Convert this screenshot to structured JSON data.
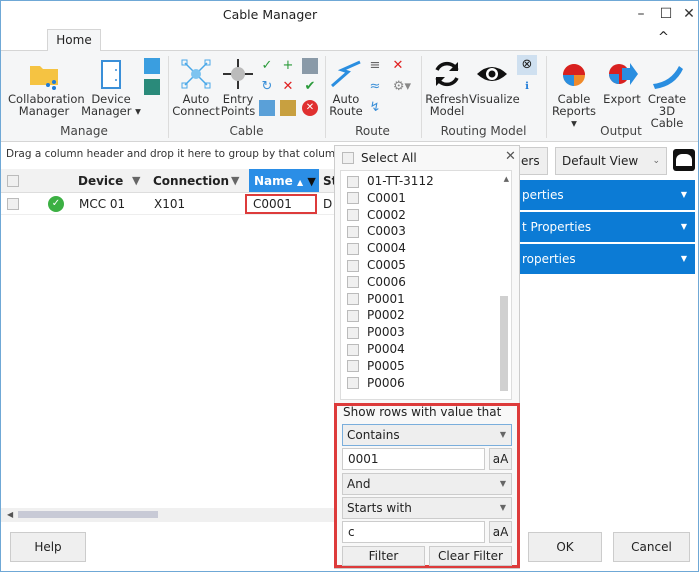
{
  "window": {
    "title": "Cable Manager",
    "minimize": "–",
    "maximize": "☐",
    "close": "✕",
    "collapse": "^"
  },
  "ribbon": {
    "tab": "Home",
    "groups": {
      "manage": {
        "label": "Manage",
        "collab": [
          "Collaboration",
          "Manager"
        ],
        "device": [
          "Device",
          "Manager ▾"
        ]
      },
      "cable": {
        "label": "Cable",
        "auto_connect": [
          "Auto",
          "Connect"
        ],
        "entry_points": [
          "Entry",
          "Points"
        ]
      },
      "route": {
        "label": "Route",
        "auto_route": [
          "Auto",
          "Route"
        ]
      },
      "routing_model": {
        "label": "Routing Model",
        "refresh": [
          "Refresh",
          "Model"
        ],
        "visualize": "Visualize"
      },
      "output": {
        "label": "Output",
        "reports": [
          "Cable",
          "Reports ▾"
        ],
        "export": "Export",
        "create3d": [
          "Create",
          "3D Cable"
        ]
      }
    }
  },
  "grid": {
    "groupby_hint": "Drag a column header and drop it here to group by that column",
    "columns": [
      "Device",
      "Connection",
      "Name",
      "St"
    ],
    "rows": [
      {
        "device": "MCC 01",
        "connection": "X101",
        "name": "C0001",
        "st": "D",
        "status": "ok"
      }
    ]
  },
  "filter_popup": {
    "select_all": "Select All",
    "items": [
      "01-TT-3112",
      "C0001",
      "C0002",
      "C0003",
      "C0004",
      "C0005",
      "C0006",
      "P0001",
      "P0002",
      "P0003",
      "P0004",
      "P0005",
      "P0006"
    ],
    "show_rows_label": "Show rows with value that",
    "operator1": "Contains",
    "value1": "0001",
    "case_label": "aA",
    "logic": "And",
    "operator2": "Starts with",
    "value2": "c",
    "filter_button": "Filter",
    "clear_button": "Clear Filter"
  },
  "right_panel": {
    "filters_button": "ers",
    "view_select": "Default View",
    "sections": [
      "perties",
      "t Properties",
      "roperties"
    ]
  },
  "footer": {
    "help": "Help",
    "ok": "OK",
    "cancel": "Cancel"
  },
  "colors": {
    "accent": "#0c7bd5",
    "header_selected": "#2b8ee6",
    "highlight": "#dd3b3b"
  }
}
